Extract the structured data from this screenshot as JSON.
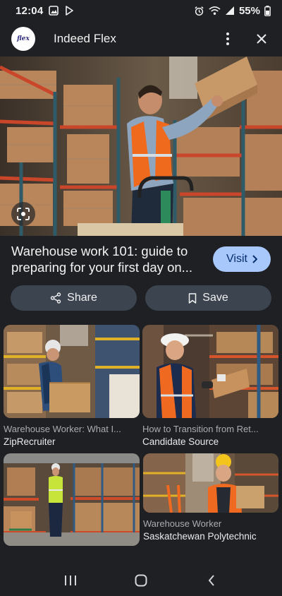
{
  "status": {
    "time": "12:04",
    "battery": "55%"
  },
  "header": {
    "logo_text": "flex",
    "site_name": "Indeed Flex"
  },
  "hero": {
    "alt_icon": "google-lens-icon"
  },
  "result": {
    "title": "Warehouse work 101: guide to preparing for your first day on...",
    "visit_label": "Visit"
  },
  "actions": {
    "share_label": "Share",
    "save_label": "Save"
  },
  "related": [
    {
      "title": "Warehouse Worker: What I...",
      "source": "ZipRecruiter"
    },
    {
      "title": "How to Transition from Ret...",
      "source": "Candidate Source"
    },
    {
      "title": "",
      "source": ""
    },
    {
      "title": "Warehouse Worker",
      "source": "Saskatchewan Polytechnic"
    }
  ],
  "colors": {
    "background": "#1f2024",
    "visit_bg": "#a8c7fa",
    "pill_bg": "#3c4450",
    "vest_orange": "#f06a1e"
  }
}
